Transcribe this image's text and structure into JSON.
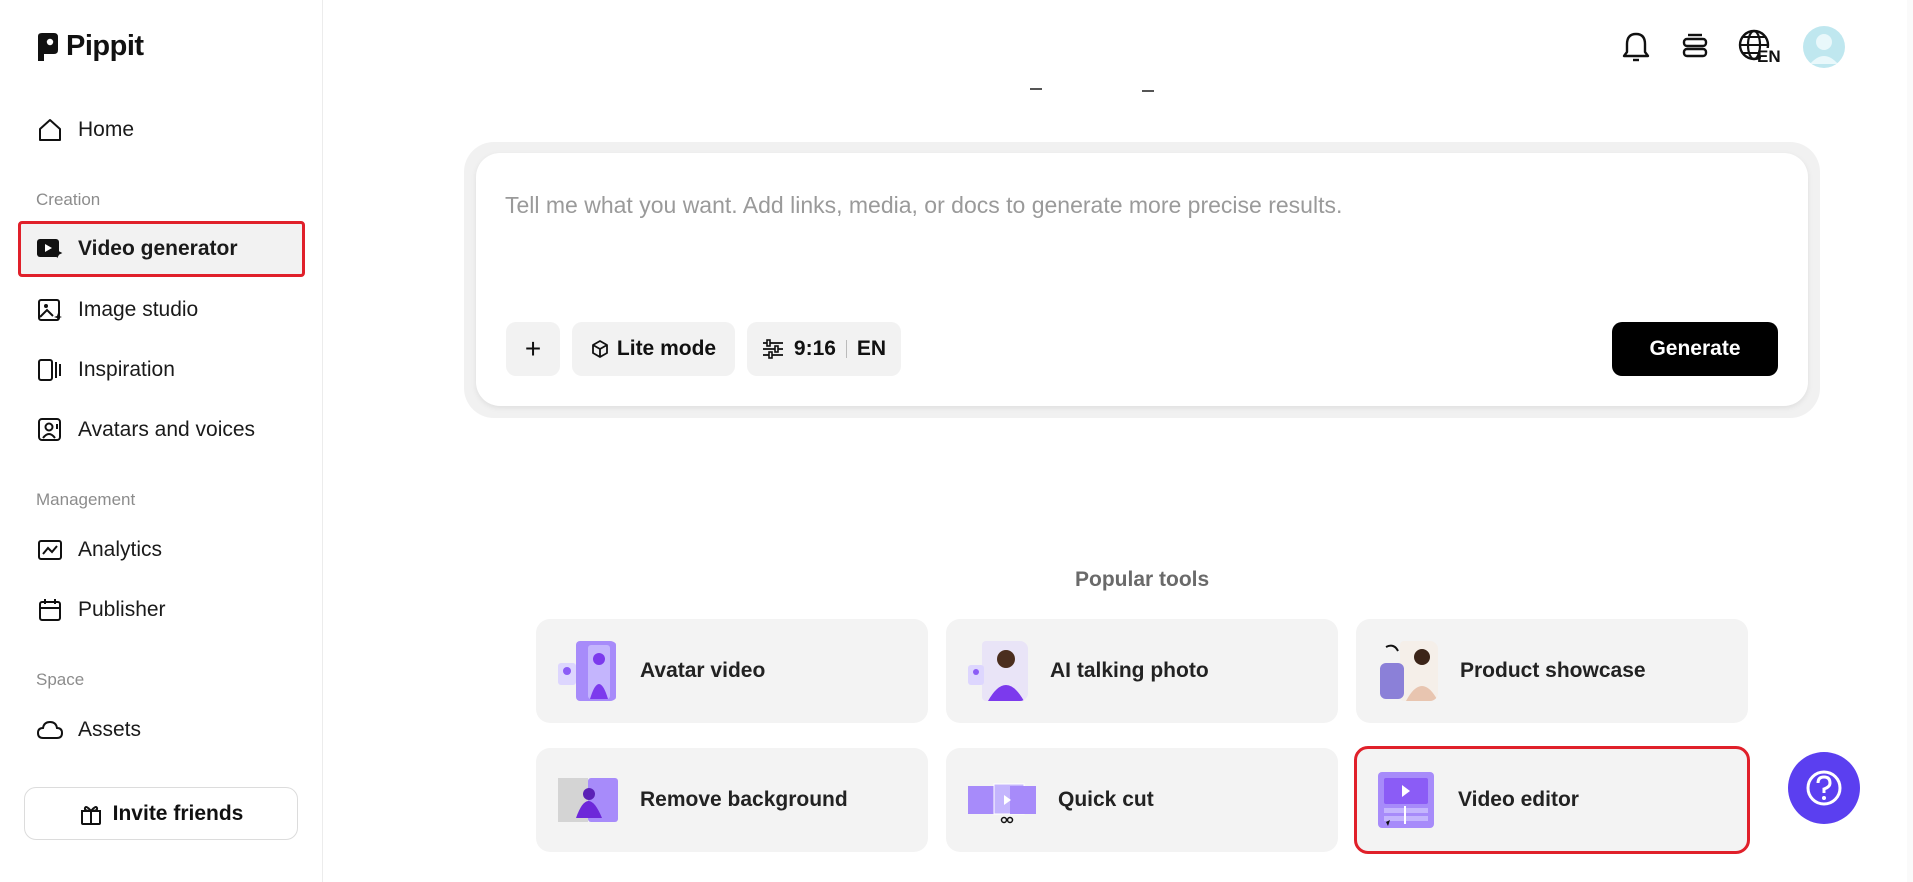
{
  "app": {
    "name": "Pippit"
  },
  "sidebar": {
    "home": "Home",
    "sections": {
      "creation": "Creation",
      "management": "Management",
      "space": "Space"
    },
    "items": {
      "video_generator": "Video generator",
      "image_studio": "Image studio",
      "inspiration": "Inspiration",
      "avatars_voices": "Avatars and voices",
      "analytics": "Analytics",
      "publisher": "Publisher",
      "assets": "Assets"
    },
    "invite": "Invite friends"
  },
  "topbar": {
    "language_code": "EN"
  },
  "prompt": {
    "placeholder": "Tell me what you want. Add links, media, or docs to generate more precise results.",
    "add_label": "+",
    "mode_label": "Lite mode",
    "ratio_label": "9:16",
    "lang_label": "EN",
    "generate_label": "Generate"
  },
  "popular": {
    "title": "Popular tools",
    "tools": [
      "Avatar video",
      "AI talking photo",
      "Product showcase",
      "Remove background",
      "Quick cut",
      "Video editor"
    ]
  },
  "colors": {
    "accent_purple": "#5b3ff0",
    "highlight_red": "#e0202a",
    "generate_bg": "#000000"
  }
}
